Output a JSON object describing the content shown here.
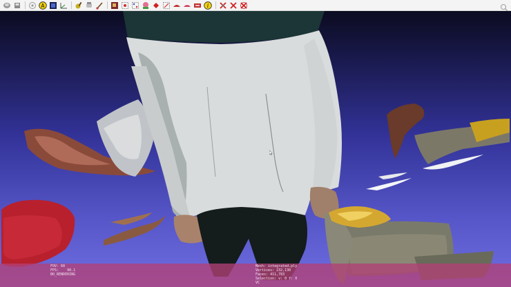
{
  "toolbar": {
    "icons": [
      "open-icon",
      "save-icon",
      "eye-icon",
      "annotate-icon",
      "layers-icon",
      "axis-icon",
      "paint-icon",
      "rotate-icon",
      "brush-icon",
      "palette-icon",
      "select-faces-icon",
      "select-vertices-icon",
      "select-connected-icon",
      "fill-icon",
      "align-icon",
      "measure-icon",
      "pick-points-icon",
      "texture-icon",
      "info-icon",
      "delete-faces-icon",
      "delete-vertices-icon",
      "delete-all-icon"
    ],
    "search_icon": "search-icon"
  },
  "viewport": {
    "background_top": "#0b0b20",
    "background_bottom": "#6f6ee2",
    "cursor_icon": "mouse-pointer-icon"
  },
  "info_bar": {
    "color": "#b24076",
    "left": {
      "fov": "FOV: 60",
      "fps": "FPS:    90.1",
      "mode": "BO_RENDERING"
    },
    "right": {
      "mesh": "Mesh: integrated.ply",
      "vertices": "Vertices: 232,130",
      "faces": "Faces: 411,783",
      "selection": "Selection: v: 0 f: 0",
      "vc": "VC"
    }
  }
}
